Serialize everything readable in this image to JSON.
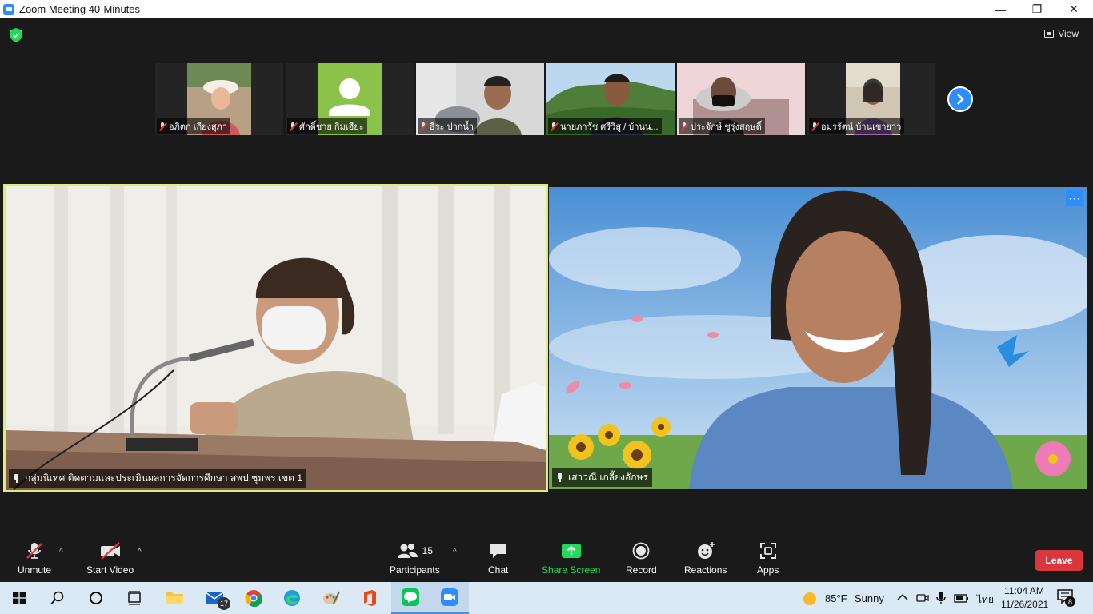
{
  "window": {
    "title": "Zoom Meeting 40-Minutes",
    "minimize_glyph": "—",
    "maximize_glyph": "❐",
    "close_glyph": "✕"
  },
  "header": {
    "view_label": "View"
  },
  "thumbnails": [
    {
      "name": "อภิตก เกียงสุภา"
    },
    {
      "name": "ศักดิ์ชาย กิมเฮียะ"
    },
    {
      "name": "ธีระ ปากน้ำ"
    },
    {
      "name": "นายภาวัช ศรีวิสู / บ้านน..."
    },
    {
      "name": "ประจักษ์ ชูรุ่งสฤษดิ์"
    },
    {
      "name": "อมรรัตน์ บ้านเขายาว"
    }
  ],
  "main_videos": [
    {
      "name": "กลุ่มนิเทศ ติดตามและประเมินผลการจัดการศึกษา สพป.ชุมพร เขต 1"
    },
    {
      "name": "เสาวณี เกลี้ยงอักษร"
    }
  ],
  "toolbar": {
    "unmute_label": "Unmute",
    "start_video_label": "Start Video",
    "participants_label": "Participants",
    "participants_count": "15",
    "chat_label": "Chat",
    "share_screen_label": "Share Screen",
    "record_label": "Record",
    "reactions_label": "Reactions",
    "apps_label": "Apps",
    "leave_label": "Leave",
    "more_label": "···",
    "caret": "^"
  },
  "taskbar": {
    "mail_badge": "17",
    "weather_temp": "85°F",
    "weather_text": "Sunny",
    "language": "ไทย",
    "time": "11:04 AM",
    "date": "11/26/2021",
    "notification_count": "8"
  },
  "colors": {
    "active_speaker_border": "#ddee77",
    "accent": "#2d8cff",
    "share_green": "#23d959",
    "leave_red": "#d9363e"
  }
}
